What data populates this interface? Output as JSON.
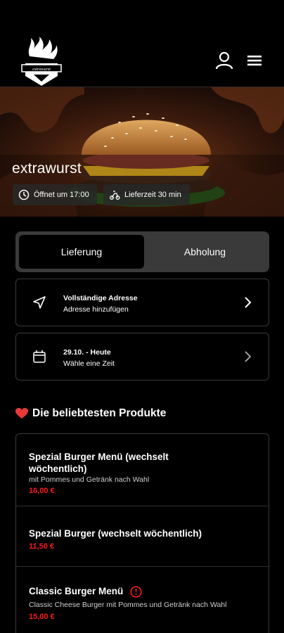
{
  "header": {
    "logo": "grill-flame-logo",
    "logo_text": "extrawurst",
    "user_icon": "user-icon",
    "menu_icon": "menu-icon"
  },
  "hero": {
    "shop_name": "extrawurst",
    "opens": "Öffnet um 17:00",
    "delivery_time": "Lieferzeit 30 min"
  },
  "mode_toggle": {
    "options": [
      "Lieferung",
      "Abholung"
    ],
    "selected": "Lieferung"
  },
  "address": {
    "title": "Vollständige Adresse",
    "subtitle": "Adresse hinzufügen"
  },
  "time": {
    "title": "29.10. - Heute",
    "subtitle": "Wähle eine Zeit"
  },
  "popular": {
    "title": "Die beliebtesten Produkte",
    "products": [
      {
        "name": "Spezial Burger Menü (wechselt wöchentlich)",
        "desc": "mit Pommes und Getränk nach Wahl",
        "price": "16,00 €"
      },
      {
        "name": "Spezial Burger (wechselt wöchentlich)",
        "desc": "",
        "price": "11,50 €"
      },
      {
        "name": "Classic Burger Menü",
        "desc": "Classic Cheese Burger mit Pommes und Getränk nach Wahl",
        "price": "15,00 €"
      }
    ]
  },
  "colors": {
    "accent": "#ff1a1a",
    "background": "#000000",
    "card_border": "#3a3a3a"
  }
}
